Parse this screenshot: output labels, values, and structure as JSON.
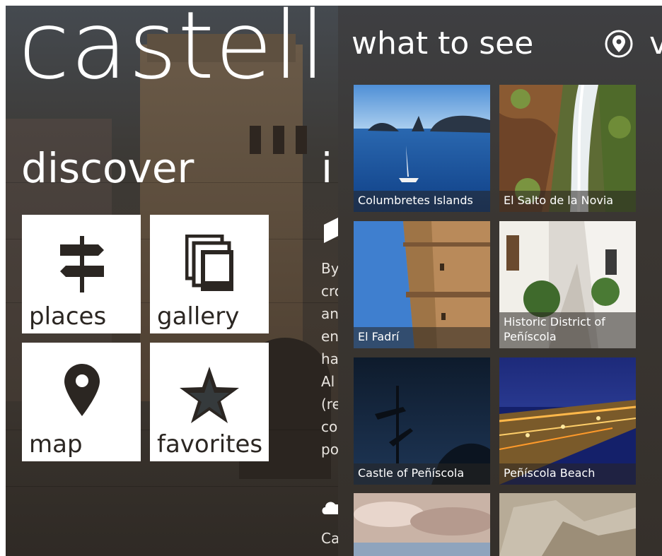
{
  "left_screen": {
    "app_title": "castell",
    "section_heading": "discover",
    "next_section_peek": "i",
    "tiles": [
      {
        "label": "places",
        "icon": "signpost-icon"
      },
      {
        "label": "gallery",
        "icon": "photos-icon"
      },
      {
        "label": "map",
        "icon": "map-pin-icon"
      },
      {
        "label": "favorites",
        "icon": "star-icon"
      }
    ],
    "peek_text_lines": [
      "By",
      "cro",
      "an",
      "en",
      "ha",
      "Al",
      "(re",
      "co",
      "po"
    ],
    "peek_footer": "Ca"
  },
  "right_screen": {
    "section_heading": "what to see",
    "next_section_icon": "map-pin-circle-icon",
    "next_section_peek": "v",
    "places": [
      {
        "caption": "Columbretes Islands"
      },
      {
        "caption": "El Salto de la Novia"
      },
      {
        "caption": "El Fadrí"
      },
      {
        "caption": "Historic District of Peñíscola"
      },
      {
        "caption": "Castle of Peñíscola"
      },
      {
        "caption": "Peñíscola Beach"
      },
      {
        "caption": ""
      },
      {
        "caption": ""
      }
    ]
  },
  "colors": {
    "tile_background": "#ffffff",
    "tile_foreground": "#2b2622",
    "text_on_dark": "#ffffff"
  }
}
